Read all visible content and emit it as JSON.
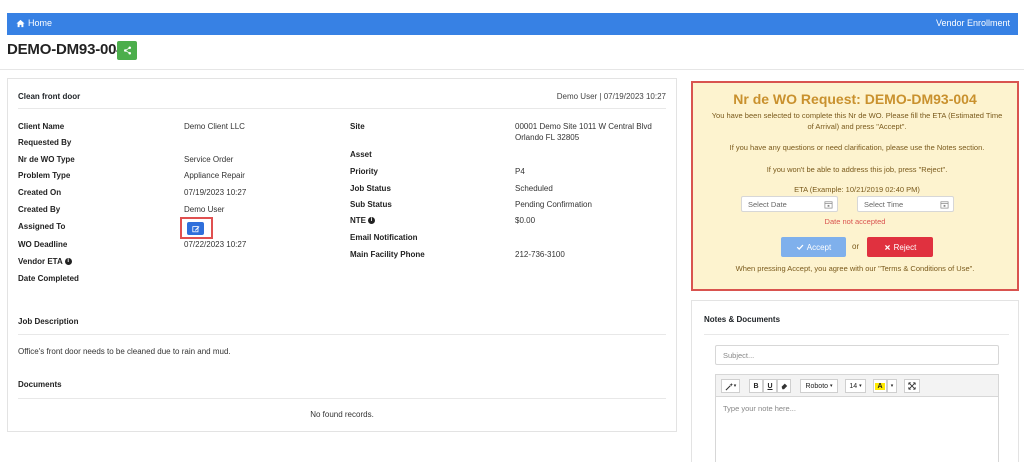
{
  "nav": {
    "home_label": "Home",
    "vendor_label": "Vendor Enrollment"
  },
  "page": {
    "title": "DEMO-DM93-004"
  },
  "wo": {
    "summary": "Clean front door",
    "meta": "Demo User | 07/19/2023 10:27",
    "left_fields": [
      {
        "label": "Client Name",
        "value": "Demo Client LLC"
      },
      {
        "label": "Requested By",
        "value": ""
      },
      {
        "label": "Nr de WO Type",
        "value": "Service Order"
      },
      {
        "label": "Problem Type",
        "value": "Appliance Repair"
      },
      {
        "label": "Created On",
        "value": "07/19/2023 10:27"
      },
      {
        "label": "Created By",
        "value": "Demo User"
      },
      {
        "label": "Assigned To",
        "value": ""
      },
      {
        "label": "WO Deadline",
        "value": "07/22/2023 10:27"
      },
      {
        "label": "Vendor ETA",
        "value": ""
      },
      {
        "label": "Date Completed",
        "value": ""
      }
    ],
    "right_fields": [
      {
        "label": "Site",
        "value_line1": "00001 Demo Site 1011 W Central Blvd",
        "value_line2": "Orlando FL 32805"
      },
      {
        "label": "Asset",
        "value": ""
      },
      {
        "label": "Priority",
        "value": "P4"
      },
      {
        "label": "Job Status",
        "value": "Scheduled"
      },
      {
        "label": "Sub Status",
        "value": "Pending Confirmation"
      },
      {
        "label": "NTE",
        "value": "$0.00"
      },
      {
        "label": "Email Notification",
        "value": ""
      },
      {
        "label": "Main Facility Phone",
        "value": "212-736-3100"
      }
    ],
    "job_description_label": "Job Description",
    "job_description": "Office's front door needs to be cleaned due to rain and mud.",
    "documents_label": "Documents",
    "no_records": "No found records."
  },
  "request": {
    "title": "Nr de WO Request: DEMO-DM93-004",
    "line1": "You have been selected to complete this Nr de WO. Please fill the ETA (Estimated Time",
    "line1b": "of Arrival) and press \"Accept\".",
    "line2": "If you have any questions or need clarification, please use the Notes section.",
    "line3": "If you won't be able to address this job, press \"Reject\".",
    "eta_label": "ETA (Example: 10/21/2019 02:40 PM)",
    "date_placeholder": "Select Date",
    "time_placeholder": "Select Time",
    "date_status": "Date not accepted",
    "accept_label": "Accept",
    "or_label": "or",
    "reject_label": "Reject",
    "footer": "When pressing Accept, you agree with our \"Terms & Conditions of Use\"."
  },
  "notes": {
    "title": "Notes & Documents",
    "subject_placeholder": "Subject...",
    "font_name": "Roboto",
    "font_size": "14",
    "body_placeholder": "Type your note here..."
  },
  "colors": {
    "navbar": "#3781e4",
    "share_button": "#4cae4c",
    "request_bg": "#fdf3cf",
    "request_border": "#d9534f",
    "accept": "#7fb0ec",
    "reject": "#e0313f"
  },
  "icons": [
    "home-icon",
    "share-icon",
    "edit-icon",
    "info-icon",
    "calendar-icon",
    "clock-icon",
    "check-icon",
    "times-icon",
    "magic-icon",
    "bold-icon",
    "underline-icon",
    "eraser-icon",
    "highlight-icon",
    "fullscreen-icon"
  ]
}
